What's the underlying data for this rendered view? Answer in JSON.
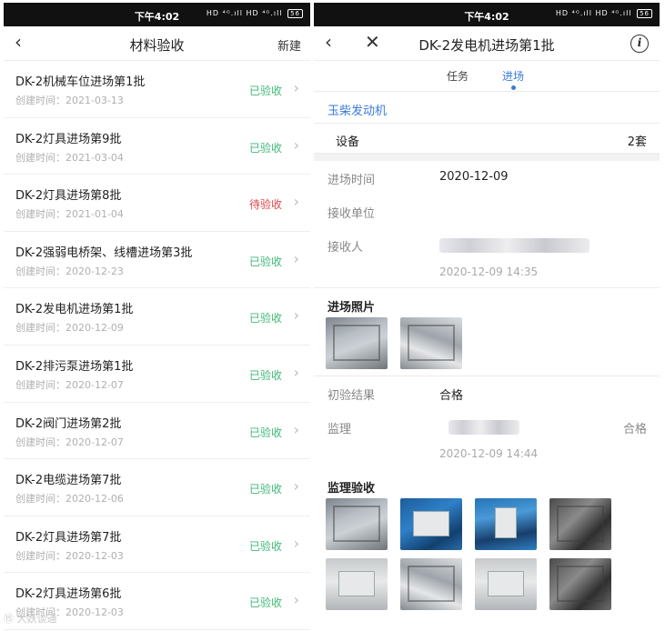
{
  "left": {
    "status": {
      "time": "下午4:02",
      "icons": "HD ⁴ᴳ.ıll HD ⁴ᴳ.ıll",
      "battery": "56"
    },
    "nav": {
      "back": "‹",
      "title": "材料验收",
      "action": "新建"
    },
    "items": [
      {
        "name": "DK-2机械车位进场第1批",
        "date": "创建时间：2021-03-13",
        "status": "已验收"
      },
      {
        "name": "DK-2灯具进场第9批",
        "date": "创建时间：2021-03-04",
        "status": "已验收"
      },
      {
        "name": "DK-2灯具进场第8批",
        "date": "创建时间：2021-01-04",
        "status": "待验收"
      },
      {
        "name": "DK-2强弱电桥架、线槽进场第3批",
        "date": "创建时间：2020-12-23",
        "status": "已验收"
      },
      {
        "name": "DK-2发电机进场第1批",
        "date": "创建时间：2020-12-09",
        "status": "已验收"
      },
      {
        "name": "DK-2排污泵进场第1批",
        "date": "创建时间：2020-12-07",
        "status": "已验收"
      },
      {
        "name": "DK-2阀门进场第2批",
        "date": "创建时间：2020-12-07",
        "status": "已验收"
      },
      {
        "name": "DK-2电缆进场第7批",
        "date": "创建时间：2020-12-06",
        "status": "已验收"
      },
      {
        "name": "DK-2灯具进场第7批",
        "date": "创建时间：2020-12-03",
        "status": "已验收"
      },
      {
        "name": "DK-2灯具进场第6批",
        "date": "创建时间：2020-12-03",
        "status": "已验收"
      }
    ],
    "chevron": "›"
  },
  "right": {
    "status": {
      "time": "下午4:02",
      "icons": "HD ⁴ᴳ.ıll HD ⁴ᴳ.ıll",
      "battery": "56"
    },
    "nav": {
      "back": "‹",
      "close": "✕",
      "title": "DK-2发电机进场第1批",
      "info": "i"
    },
    "tabs": [
      "任务",
      "进场"
    ],
    "supplier": "玉柴发动机",
    "device": {
      "label": "设备",
      "value": "2套"
    },
    "entry_time": {
      "label": "进场时间",
      "value": "2020-12-09"
    },
    "receiver_unit": {
      "label": "接收单位",
      "value": ""
    },
    "receiver": {
      "label": "接收人",
      "timestamp": "2020-12-09 14:35"
    },
    "entry_photos_title": "进场照片",
    "initial_result": {
      "label": "初验结果",
      "value": "合格"
    },
    "supervisor": {
      "label": "监理",
      "result": "合格",
      "timestamp": "2020-12-09 14:44"
    },
    "supervision_title": "监理验收"
  },
  "colors": {
    "accent": "#3a7bd5",
    "ok": "#3fb877",
    "pending": "#e0464b"
  },
  "watermark": "⑮ 大妖谈通"
}
